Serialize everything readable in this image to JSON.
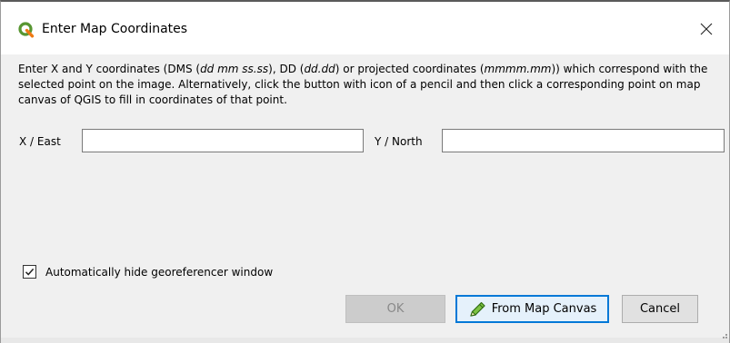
{
  "window": {
    "title": "Enter Map Coordinates",
    "logo_icon": "qgis-logo-icon",
    "close_icon": "close-icon",
    "accent_color": "#0078d7"
  },
  "instructions": {
    "part1": "Enter X and Y coordinates (DMS (",
    "dms_format": "dd mm ss.ss",
    "part2": "), DD (",
    "dd_format": "dd.dd",
    "part3": ") or projected coordinates (",
    "proj_format": "mmmm.mm",
    "part4": ")) which correspond with the selected point on the image. Alternatively, click the button with icon of a pencil and then click a corresponding point on map canvas of QGIS to fill in coordinates of that point."
  },
  "fields": {
    "x_label": "X / East",
    "x_value": "",
    "y_label": "Y / North",
    "y_value": ""
  },
  "checkbox": {
    "label": "Automatically hide georeferencer window",
    "checked": true
  },
  "buttons": {
    "ok": "OK",
    "ok_enabled": false,
    "from_map_canvas": "From Map Canvas",
    "pencil_icon": "pencil-icon",
    "cancel": "Cancel"
  }
}
